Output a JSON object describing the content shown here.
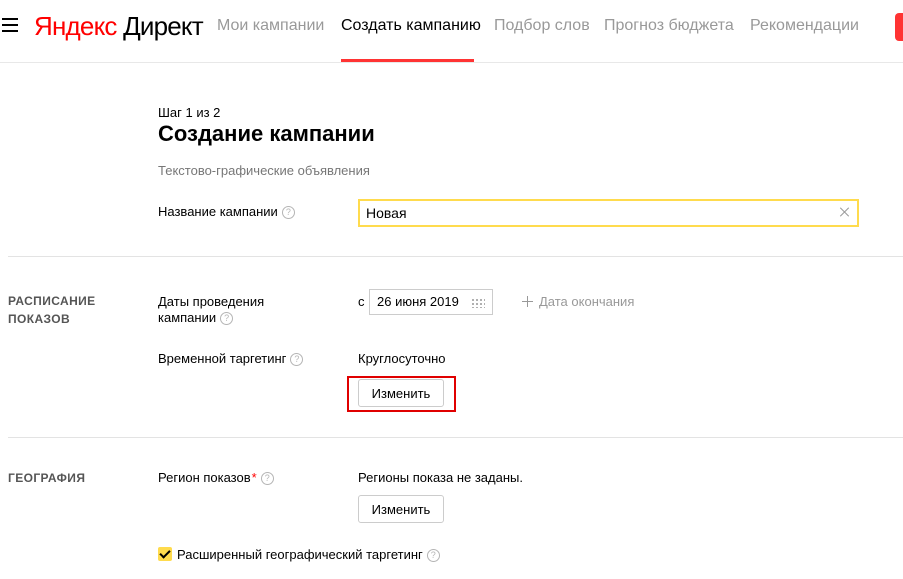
{
  "header": {
    "logo_part1": "Яндекс",
    "logo_part2": "Директ",
    "nav": [
      "Мои кампании",
      "Создать кампанию",
      "Подбор слов",
      "Прогноз бюджета",
      "Рекомендации"
    ]
  },
  "page": {
    "step": "Шаг 1 из 2",
    "title": "Создание кампании",
    "subtitle": "Текстово-графические объявления"
  },
  "campaign_name": {
    "label": "Название кампании",
    "value": "Новая"
  },
  "schedule": {
    "section_line1": "РАСПИСАНИЕ",
    "section_line2": "ПОКАЗОВ",
    "dates_label_line1": "Даты проведения",
    "dates_label_line2": "кампании",
    "from_prefix": "с",
    "start_date": "26 июня 2019",
    "end_date_link": "Дата окончания",
    "time_targeting_label": "Временной таргетинг",
    "time_targeting_value": "Круглосуточно",
    "change_button": "Изменить"
  },
  "geography": {
    "section": "ГЕОГРАФИЯ",
    "region_label": "Регион показов",
    "required_mark": "*",
    "region_value": "Регионы показа не заданы.",
    "change_button": "Изменить",
    "extended_targeting_label": "Расширенный географический таргетинг",
    "extended_targeting_checked": true
  },
  "help_glyph": "?",
  "colors": {
    "accent_red": "#ff3333",
    "input_focus": "#ffdb4d",
    "highlight_box": "#e00000"
  }
}
